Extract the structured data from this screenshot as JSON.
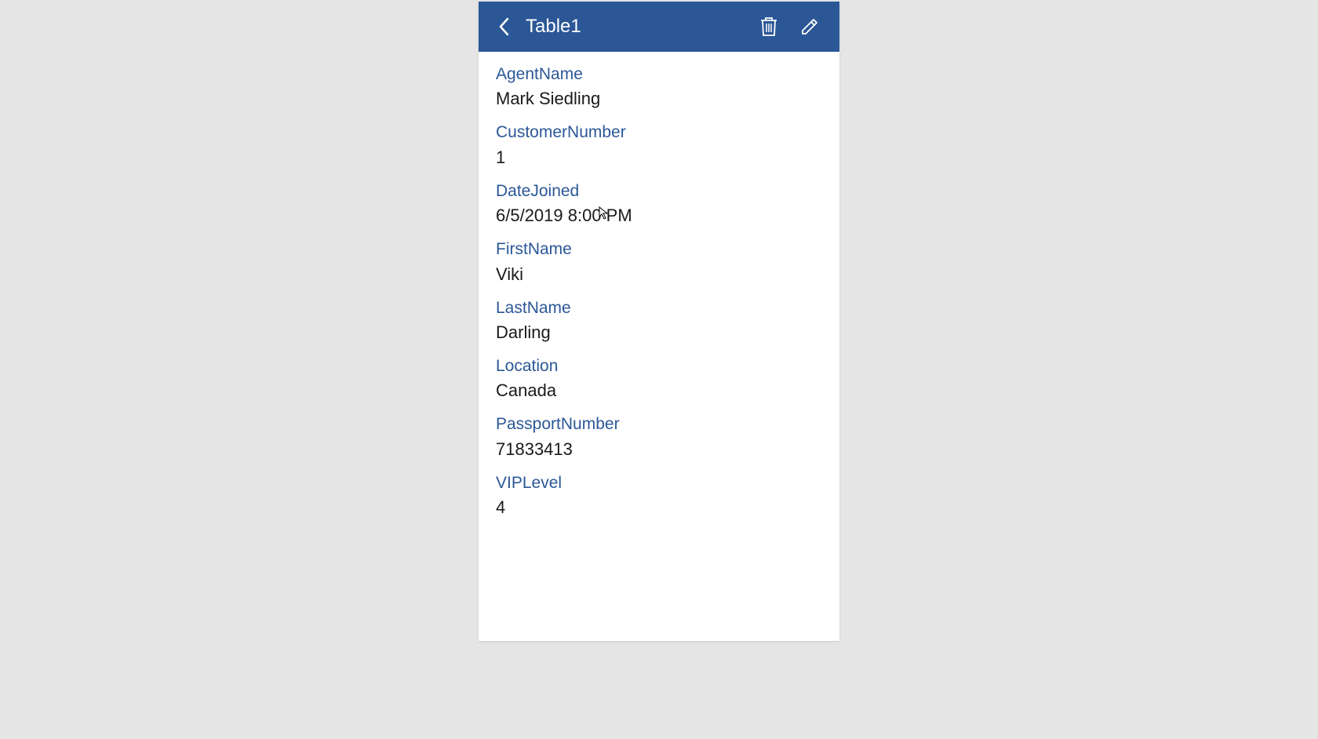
{
  "header": {
    "title": "Table1"
  },
  "fields": {
    "agentName": {
      "label": "AgentName",
      "value": "Mark Siedling"
    },
    "customerNumber": {
      "label": "CustomerNumber",
      "value": "1"
    },
    "dateJoined": {
      "label": "DateJoined",
      "value": "6/5/2019 8:00 PM"
    },
    "firstName": {
      "label": "FirstName",
      "value": "Viki"
    },
    "lastName": {
      "label": "LastName",
      "value": "Darling"
    },
    "location": {
      "label": "Location",
      "value": "Canada"
    },
    "passportNumber": {
      "label": "PassportNumber",
      "value": "71833413"
    },
    "vipLevel": {
      "label": "VIPLevel",
      "value": "4"
    }
  }
}
